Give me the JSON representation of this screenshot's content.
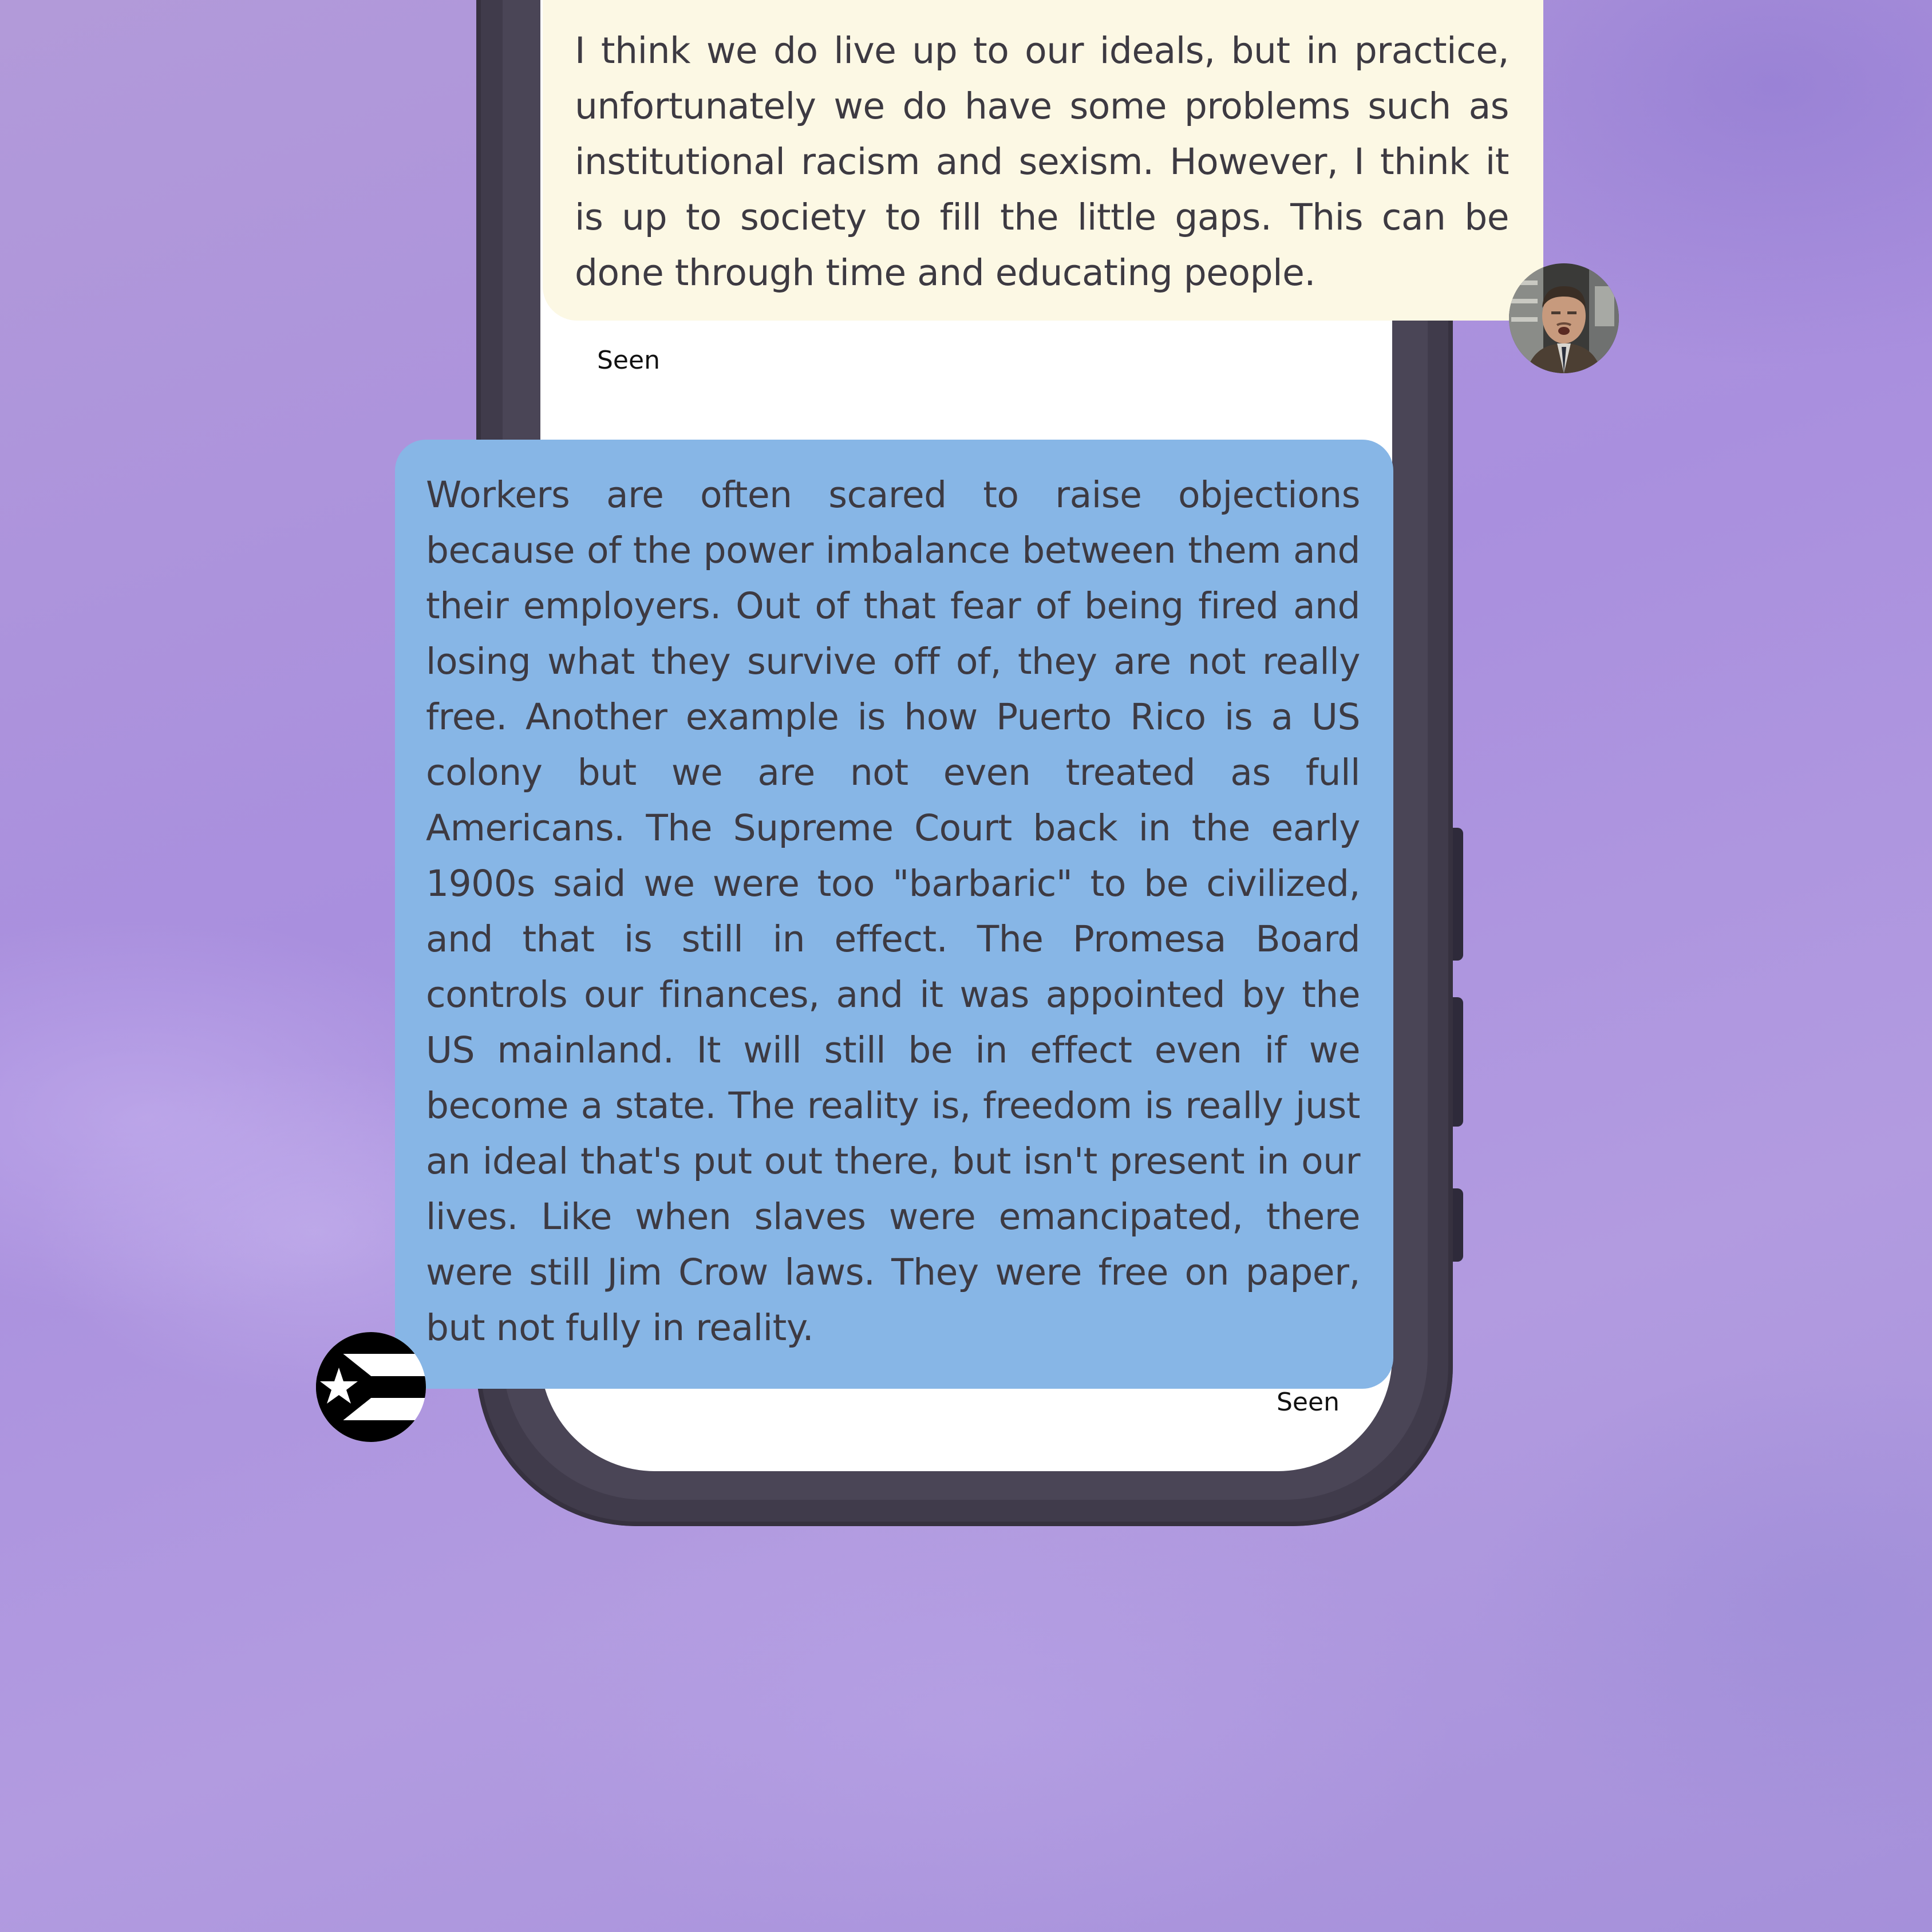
{
  "messages": [
    {
      "direction": "received",
      "text": "I think we do live up to our ideals, but in practice, unfortunately we do have some problems such as institutional racism and sexism. However, I think it is up to society to fill the little gaps. This can be done through time and educating people.",
      "status": "Seen",
      "avatar_icon": "man-photo-avatar",
      "bubble_color": "#fcf8e4"
    },
    {
      "direction": "sent",
      "text": "Workers are often scared to raise objections because of the power imbalance between them and their employers. Out of that fear of being fired and losing what they survive off of, they are not really free. Another example is how Puerto Rico is a US colony but we are not even treated as full Americans. The Supreme Court back in the early 1900s said we were too \"barbaric\" to be civilized, and that is still in effect. The Promesa Board controls our finances, and it was appointed by the US mainland. It will still be in effect even if we become a state. The reality is, freedom is really just an ideal that's put out there, but isn't present in our lives. Like when slaves were emancipated, there were still Jim Crow laws. They were free on paper, but not fully in reality.",
      "status": "Seen",
      "avatar_icon": "black-puerto-rico-flag-avatar",
      "bubble_color": "#87b6e6"
    }
  ],
  "colors": {
    "background": "#b29ad9",
    "phone_body": "#403b4b",
    "text": "#3d3a42"
  }
}
